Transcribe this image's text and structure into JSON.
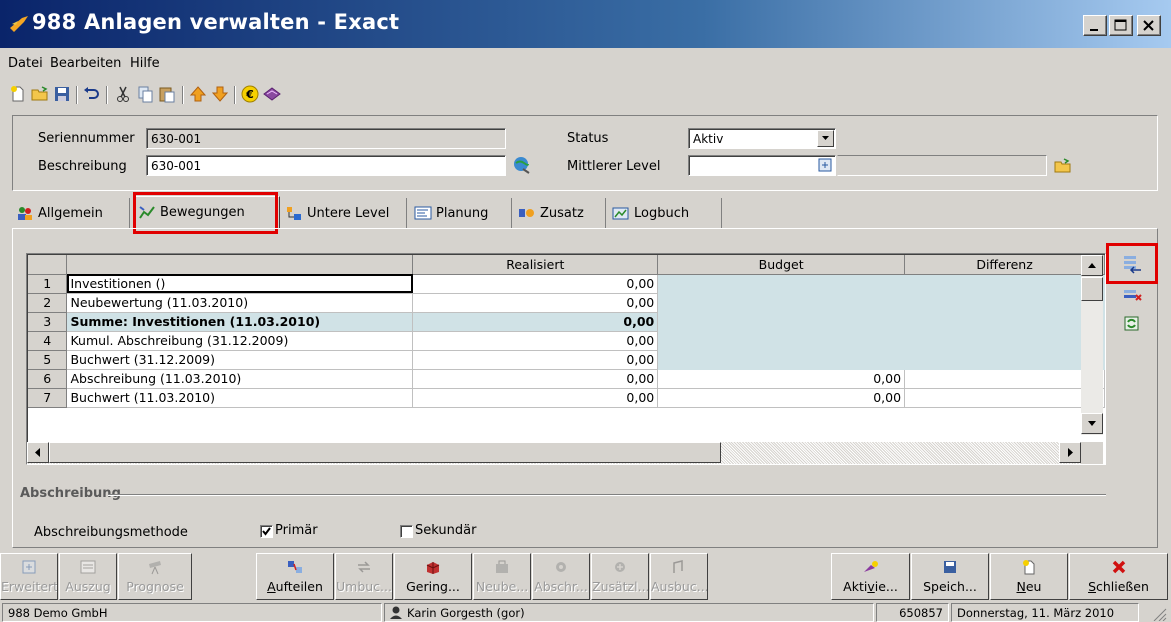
{
  "window": {
    "title": "988 Anlagen verwalten - Exact"
  },
  "menu": [
    "Datei",
    "Bearbeiten",
    "Hilfe"
  ],
  "header": {
    "seriennummer_label": "Seriennummer",
    "seriennummer_value": "630-001",
    "beschreibung_label": "Beschreibung",
    "beschreibung_value": "630-001",
    "status_label": "Status",
    "status_value": "Aktiv",
    "mittlerer_level_label": "Mittlerer Level",
    "mittlerer_level_value": ""
  },
  "tabs": [
    {
      "label": "Allgemein",
      "icon": "people-icon"
    },
    {
      "label": "Bewegungen",
      "icon": "chart-icon"
    },
    {
      "label": "Untere Level",
      "icon": "hierarchy-icon"
    },
    {
      "label": "Planung",
      "icon": "planning-icon"
    },
    {
      "label": "Zusatz",
      "icon": "extra-icon"
    },
    {
      "label": "Logbuch",
      "icon": "logbook-icon"
    }
  ],
  "grid": {
    "columns": [
      "",
      "Realisiert",
      "Budget",
      "Differenz"
    ],
    "rows": [
      {
        "n": "1",
        "label": "Investitionen ()",
        "realisiert": "0,00",
        "budget": "",
        "differenz": ""
      },
      {
        "n": "2",
        "label": "Neubewertung (11.03.2010)",
        "realisiert": "0,00",
        "budget": "",
        "differenz": ""
      },
      {
        "n": "3",
        "label": "Summe: Investitionen (11.03.2010)",
        "realisiert": "0,00",
        "budget": "",
        "differenz": ""
      },
      {
        "n": "4",
        "label": "Kumul. Abschreibung (31.12.2009)",
        "realisiert": "0,00",
        "budget": "",
        "differenz": ""
      },
      {
        "n": "5",
        "label": "Buchwert (31.12.2009)",
        "realisiert": "0,00",
        "budget": "",
        "differenz": ""
      },
      {
        "n": "6",
        "label": "Abschreibung (11.03.2010)",
        "realisiert": "0,00",
        "budget": "0,00",
        "differenz": ""
      },
      {
        "n": "7",
        "label": "Buchwert (11.03.2010)",
        "realisiert": "0,00",
        "budget": "0,00",
        "differenz": ""
      }
    ]
  },
  "abschreibung": {
    "group_label": "Abschreibung",
    "methode_label": "Abschreibungsmethode",
    "primaer_label": "Primär",
    "primaer_checked": true,
    "sekundaer_label": "Sekundär",
    "sekundaer_checked": false
  },
  "buttons": {
    "erweitert": "Erweitert",
    "auszug": "Auszug",
    "prognose": "Prognose",
    "aufteilen": "Aufteilen",
    "umbuc": "Umbuc...",
    "gering": "Gering...",
    "neube": "Neube...",
    "abschr": "Abschr...",
    "zusaetzl": "Zusätzl...",
    "ausbuc": "Ausbuc...",
    "aktivie": "Aktivie...",
    "speich": "Speich...",
    "neu": "Neu",
    "schliessen": "Schließen"
  },
  "status": {
    "company": "988 Demo GmbH",
    "user": "Karin Gorgesth (gor)",
    "number": "650857",
    "date": "Donnerstag, 11. März 2010"
  },
  "colors": {
    "title_start": "#0a246a",
    "title_end": "#a6caf0",
    "highlight_red": "#e00000",
    "shade": "#d0e2e6"
  }
}
